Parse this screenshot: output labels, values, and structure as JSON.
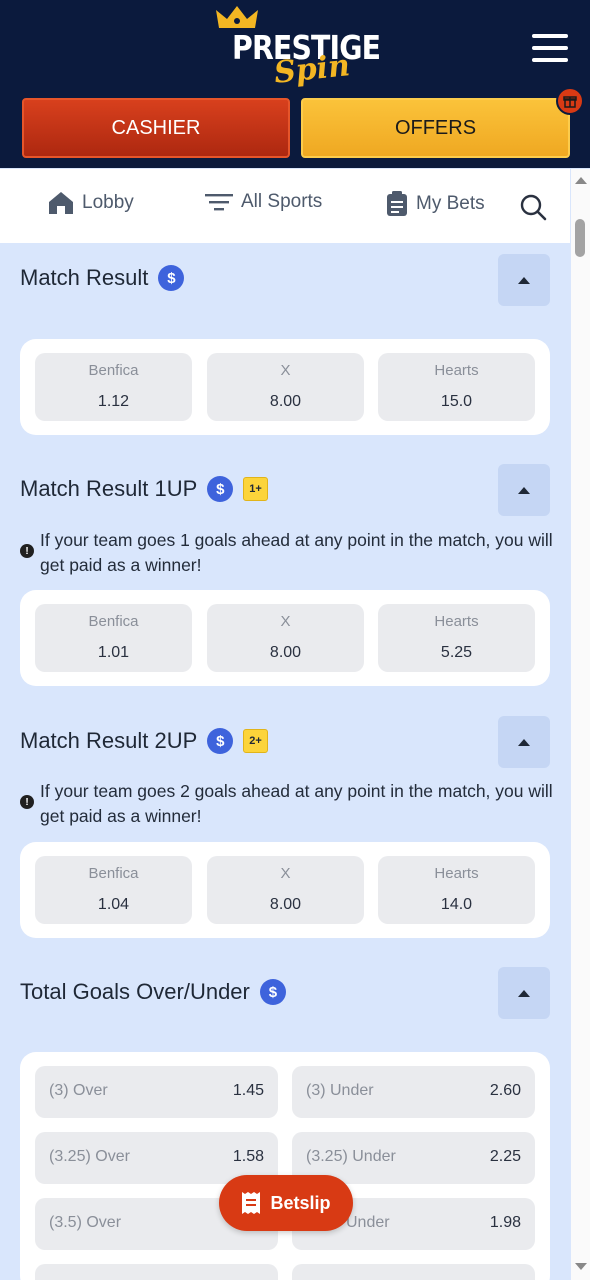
{
  "header": {
    "logo_text": "PRESTIGE",
    "logo_script": "Spin",
    "cashier_label": "CASHIER",
    "offers_label": "OFFERS",
    "brand_navy": "#0b1a3d",
    "accent_red": "#d83a14",
    "accent_gold": "#f5b52a"
  },
  "nav": {
    "items": [
      {
        "label": "Lobby",
        "icon": "home-icon"
      },
      {
        "label": "All Sports",
        "icon": "filter-lines-icon"
      },
      {
        "label": "My Bets",
        "icon": "clipboard-icon"
      }
    ],
    "search_icon": "search-icon"
  },
  "markets": [
    {
      "title": "Match Result",
      "badge": "",
      "info": "",
      "odds": [
        {
          "label": "Benfica",
          "value": "1.12"
        },
        {
          "label": "X",
          "value": "8.00"
        },
        {
          "label": "Hearts",
          "value": "15.0"
        }
      ]
    },
    {
      "title": "Match Result 1UP",
      "badge": "1+",
      "info": "If your team goes 1 goals ahead at any point in the match, you will get paid as a winner!",
      "odds": [
        {
          "label": "Benfica",
          "value": "1.01"
        },
        {
          "label": "X",
          "value": "8.00"
        },
        {
          "label": "Hearts",
          "value": "5.25"
        }
      ]
    },
    {
      "title": "Match Result 2UP",
      "badge": "2+",
      "info": "If your team goes 2 goals ahead at any point in the match, you will get paid as a winner!",
      "odds": [
        {
          "label": "Benfica",
          "value": "1.04"
        },
        {
          "label": "X",
          "value": "8.00"
        },
        {
          "label": "Hearts",
          "value": "14.0"
        }
      ]
    },
    {
      "title": "Total Goals Over/Under",
      "rows": [
        {
          "over_label": "(3) Over",
          "over_value": "1.45",
          "under_label": "(3) Under",
          "under_value": "2.60"
        },
        {
          "over_label": "(3.25) Over",
          "over_value": "1.58",
          "under_label": "(3.25) Under",
          "under_value": "2.25"
        },
        {
          "over_label": "(3.5) Over",
          "over_value": "",
          "under_label": "Under",
          "under_value": "1.98"
        }
      ]
    }
  ],
  "betslip_label": "Betslip"
}
